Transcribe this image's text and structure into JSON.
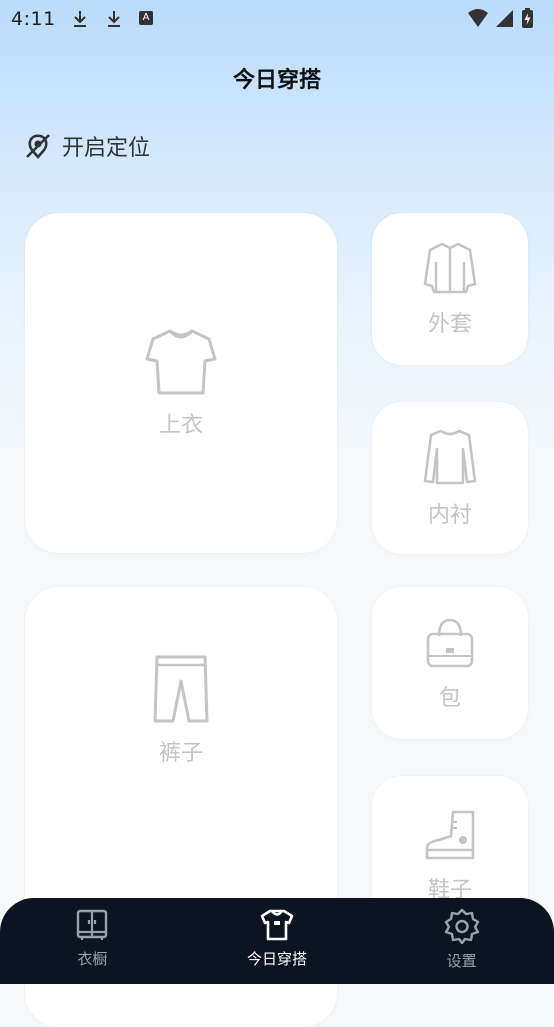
{
  "status_bar": {
    "time": "4:11",
    "icons": [
      "download-icon",
      "download-icon",
      "a-notification-icon",
      "wifi-icon",
      "signal-icon",
      "battery-charging-icon"
    ]
  },
  "header": {
    "title": "今日穿搭"
  },
  "location": {
    "label": "开启定位",
    "icon": "location-off-icon"
  },
  "categories": [
    {
      "label": "上衣",
      "icon": "tshirt-icon"
    },
    {
      "label": "外套",
      "icon": "jacket-icon"
    },
    {
      "label": "内衬",
      "icon": "long-sleeve-icon"
    },
    {
      "label": "裤子",
      "icon": "pants-icon"
    },
    {
      "label": "包",
      "icon": "bag-icon"
    },
    {
      "label": "鞋子",
      "icon": "boot-icon"
    }
  ],
  "bottom_nav": {
    "items": [
      {
        "label": "衣橱",
        "icon": "wardrobe-icon",
        "active": false
      },
      {
        "label": "今日穿搭",
        "icon": "outfit-icon",
        "active": true
      },
      {
        "label": "设置",
        "icon": "gear-icon",
        "active": false
      }
    ]
  },
  "colors": {
    "nav_bg": "#0d1421",
    "active": "#ffffff",
    "inactive": "#9aa1ab",
    "card_icon": "#c4c4c4"
  }
}
